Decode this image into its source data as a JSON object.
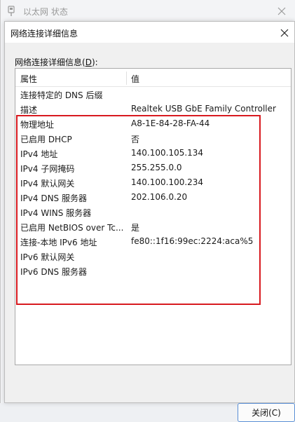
{
  "parent_window": {
    "title": "以太网 状态"
  },
  "dialog": {
    "title": "网络连接详细信息",
    "section_label_prefix": "网络连接详细信息(",
    "section_label_access": "D",
    "section_label_suffix": "):",
    "columns": {
      "property": "属性",
      "value": "值"
    },
    "rows": [
      {
        "property": "连接特定的 DNS 后缀",
        "value": ""
      },
      {
        "property": "描述",
        "value": "Realtek USB GbE Family Controller"
      },
      {
        "property": "物理地址",
        "value": "A8-1E-84-28-FA-44"
      },
      {
        "property": "已启用 DHCP",
        "value": "否"
      },
      {
        "property": "IPv4 地址",
        "value": "140.100.105.134"
      },
      {
        "property": "IPv4 子网掩码",
        "value": "255.255.0.0"
      },
      {
        "property": "IPv4 默认网关",
        "value": "140.100.100.234"
      },
      {
        "property": "IPv4 DNS 服务器",
        "value": "202.106.0.20"
      },
      {
        "property": "IPv4 WINS 服务器",
        "value": ""
      },
      {
        "property": "已启用 NetBIOS over Tc...",
        "value": "是"
      },
      {
        "property": "连接-本地 IPv6 地址",
        "value": "fe80::1f16:99ec:2224:aca%5"
      },
      {
        "property": "IPv6 默认网关",
        "value": ""
      },
      {
        "property": "IPv6 DNS 服务器",
        "value": ""
      }
    ],
    "close_button": {
      "label": "关闭(C)"
    },
    "highlight_color": "#d8191f"
  }
}
